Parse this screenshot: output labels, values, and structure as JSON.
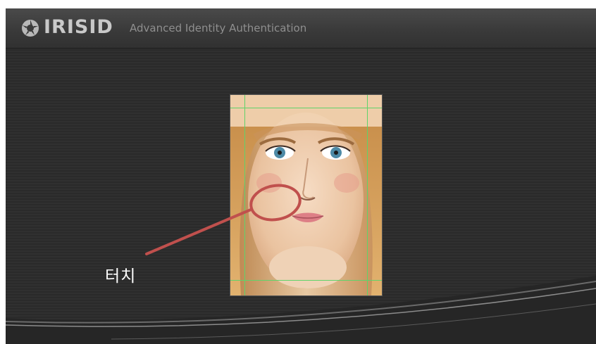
{
  "header": {
    "brand": "IRISID",
    "tagline": "Advanced Identity Authentication",
    "logo_icon": "aperture-logo-icon"
  },
  "preview": {
    "subject": "face-photo",
    "guide_color": "#5fd36a"
  },
  "annotation": {
    "label": "터치",
    "color": "#c0504d"
  }
}
